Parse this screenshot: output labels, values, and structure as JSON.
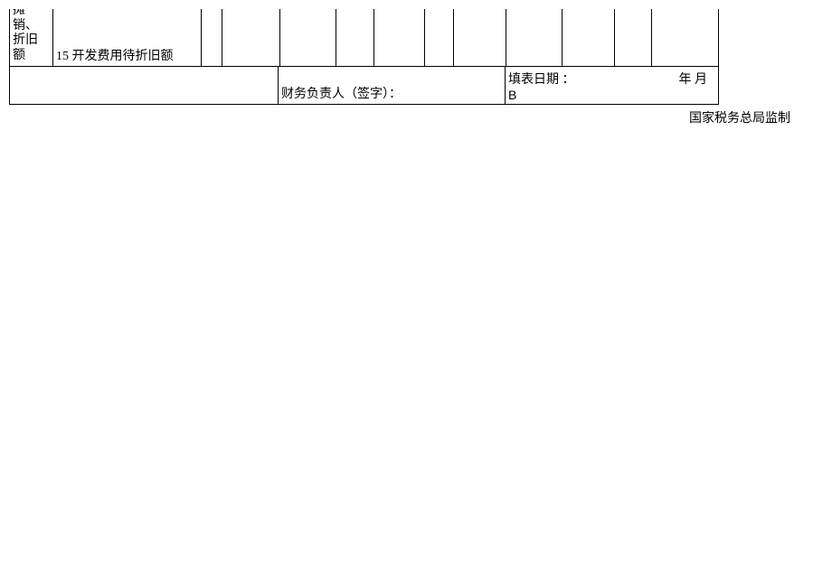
{
  "table": {
    "row1_label": "摊销、折旧额",
    "row1_item": "15 开发费用待折旧额",
    "signature_label": "财务负责人（签字）：",
    "date_label": "填表日期",
    "date_colon": "：",
    "date_suffix": "年 月",
    "date_letter": "B"
  },
  "footer": "国家税务总局监制"
}
